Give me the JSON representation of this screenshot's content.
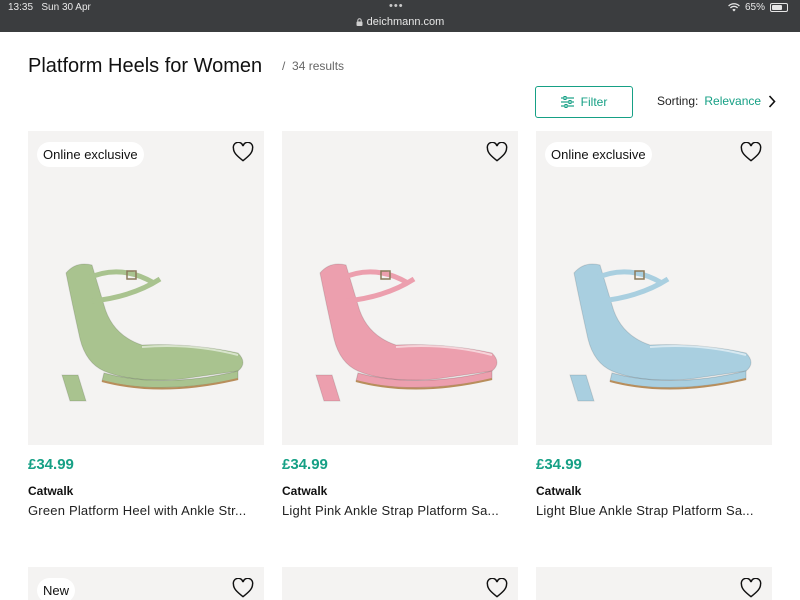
{
  "status": {
    "time": "13:35",
    "date": "Sun 30 Apr",
    "url": "deichmann.com",
    "battery": "65%",
    "battery_level": 0.65
  },
  "header": {
    "title": "Platform Heels for Women",
    "results": "34 results"
  },
  "controls": {
    "filter_label": "Filter",
    "sorting_label": "Sorting:",
    "sorting_value": "Relevance"
  },
  "products": [
    {
      "badge": "Online exclusive",
      "price": "£34.99",
      "brand": "Catwalk",
      "name": "Green Platform Heel with Ankle Str...",
      "color": "#a9c38f"
    },
    {
      "badge": "",
      "price": "£34.99",
      "brand": "Catwalk",
      "name": "Light Pink Ankle Strap Platform Sa...",
      "color": "#ec9fae"
    },
    {
      "badge": "Online exclusive",
      "price": "£34.99",
      "brand": "Catwalk",
      "name": "Light Blue Ankle Strap Platform Sa...",
      "color": "#a9cfe0"
    }
  ],
  "products_row2": [
    {
      "badge": "New"
    },
    {
      "badge": ""
    },
    {
      "badge": ""
    }
  ],
  "colors": {
    "accent": "#16a085"
  }
}
